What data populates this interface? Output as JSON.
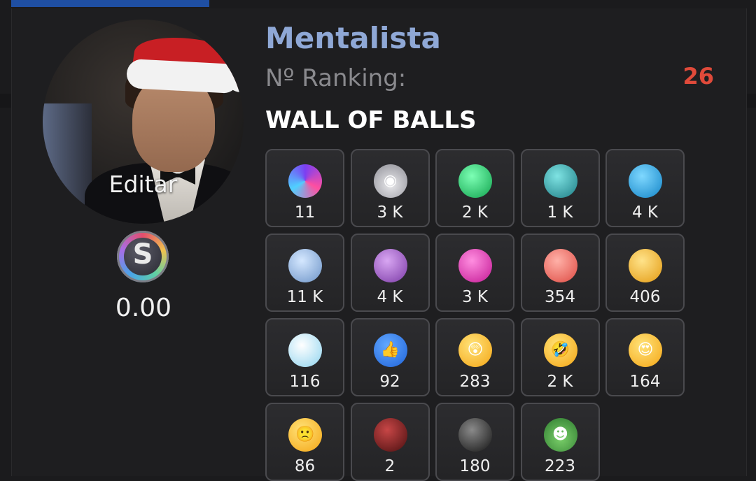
{
  "profile": {
    "avatar_icon": "user-avatar-santa-hat",
    "edit_label": "Editar",
    "currency_icon": "s-coin-icon",
    "balance": "0.00",
    "username": "Mentalista",
    "ranking_label": "Nº Ranking:",
    "ranking_value": "26"
  },
  "wall": {
    "title": "WALL OF BALLS",
    "balls": [
      {
        "icon": "galaxy-ball-icon",
        "count": "11"
      },
      {
        "icon": "santa-robot-ball-icon",
        "count": "3 K"
      },
      {
        "icon": "green-gem-ball-icon",
        "count": "2 K"
      },
      {
        "icon": "teal-gem-ball-icon",
        "count": "1 K"
      },
      {
        "icon": "blue-gem-ball-icon",
        "count": "4 K"
      },
      {
        "icon": "light-blue-gem-ball-icon",
        "count": "11 K"
      },
      {
        "icon": "purple-gem-ball-icon",
        "count": "4 K"
      },
      {
        "icon": "magenta-gem-ball-icon",
        "count": "3 K"
      },
      {
        "icon": "red-gem-ball-icon",
        "count": "354"
      },
      {
        "icon": "gold-gem-ball-icon",
        "count": "406"
      },
      {
        "icon": "diamond-ball-icon",
        "count": "116"
      },
      {
        "icon": "thumbs-up-ball-icon",
        "count": "92"
      },
      {
        "icon": "surprised-emoji-icon",
        "count": "283"
      },
      {
        "icon": "laughing-emoji-icon",
        "count": "2 K"
      },
      {
        "icon": "heart-eyes-emoji-icon",
        "count": "164"
      },
      {
        "icon": "confused-emoji-icon",
        "count": "86"
      },
      {
        "icon": "dark-red-gem-ball-icon",
        "count": "2"
      },
      {
        "icon": "black-gem-ball-icon",
        "count": "180"
      },
      {
        "icon": "grinch-santa-ball-icon",
        "count": "223"
      }
    ]
  },
  "colors": {
    "username": "#8fa8d6",
    "ranking_value": "#e04a3a",
    "accent_bar": "#1f4fa3"
  }
}
